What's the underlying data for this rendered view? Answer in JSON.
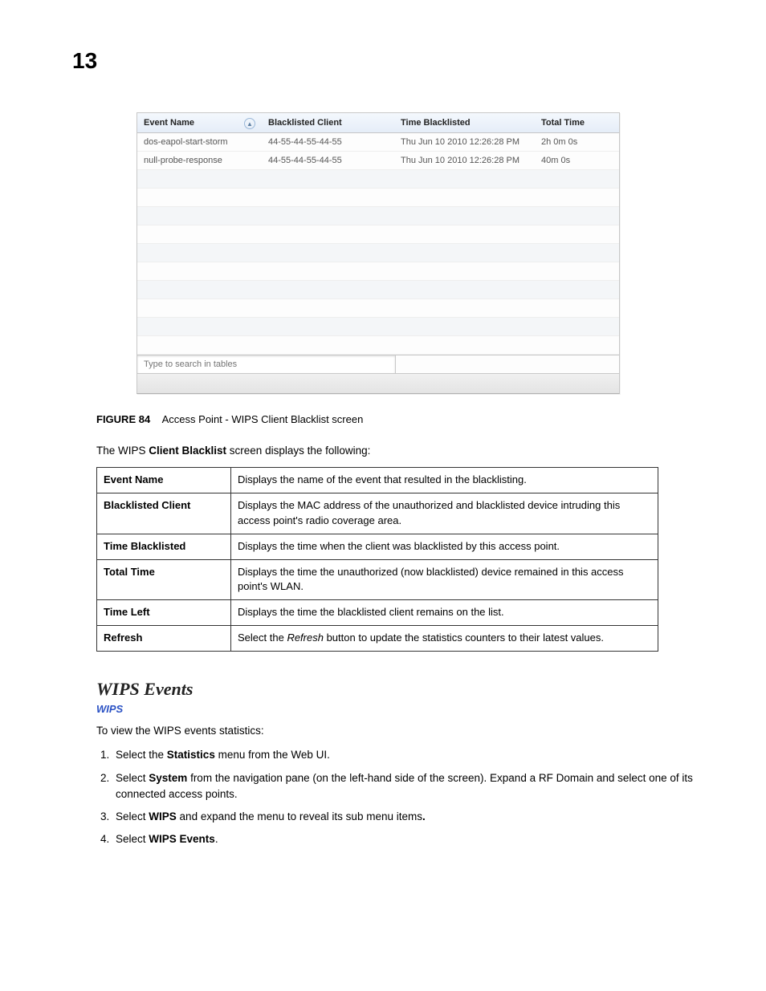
{
  "page_number": "13",
  "screenshot": {
    "columns": [
      "Event Name",
      "Blacklisted Client",
      "Time Blacklisted",
      "Total Time"
    ],
    "rows": [
      {
        "event": "dos-eapol-start-storm",
        "client": "44-55-44-55-44-55",
        "time": "Thu Jun 10 2010 12:26:28 PM",
        "total": "2h 0m 0s"
      },
      {
        "event": "null-probe-response",
        "client": "44-55-44-55-44-55",
        "time": "Thu Jun 10 2010 12:26:28 PM",
        "total": "40m 0s"
      }
    ],
    "search_placeholder": "Type to search in tables"
  },
  "figure": {
    "label": "FIGURE 84",
    "title": "Access Point - WIPS Client Blacklist screen"
  },
  "intro_prefix": "The WIPS ",
  "intro_bold": "Client Blacklist",
  "intro_suffix": " screen displays the following:",
  "defs": [
    {
      "term": "Event Name",
      "desc": "Displays the name of the event that resulted in the blacklisting."
    },
    {
      "term": "Blacklisted Client",
      "desc": "Displays the MAC address of the unauthorized and blacklisted device intruding this access point's radio coverage area."
    },
    {
      "term": "Time Blacklisted",
      "desc": "Displays the time when the client was blacklisted by this access point."
    },
    {
      "term": "Total Time",
      "desc": "Displays the time the unauthorized (now blacklisted) device remained in this access point's WLAN."
    },
    {
      "term": "Time Left",
      "desc": "Displays the time the blacklisted client remains on the list."
    },
    {
      "term": "Refresh",
      "desc_pre": "Select the ",
      "desc_em": "Refresh",
      "desc_post": " button to update the statistics counters to their latest values."
    }
  ],
  "section_heading": "WIPS Events",
  "section_link": "WIPS",
  "section_intro": "To view the WIPS events statistics:",
  "steps": {
    "s1_pre": "Select the ",
    "s1_b": "Statistics",
    "s1_post": " menu from the Web UI.",
    "s2_pre": "Select ",
    "s2_b": "System",
    "s2_post": " from the navigation pane (on the left-hand side of the screen). Expand a RF Domain and select one of its connected access points.",
    "s3_pre": "Select ",
    "s3_b": "WIPS",
    "s3_post": " and expand the menu to reveal its sub menu items",
    "s3_end": ".",
    "s4_pre": "Select ",
    "s4_b": "WIPS Events",
    "s4_post": "."
  }
}
